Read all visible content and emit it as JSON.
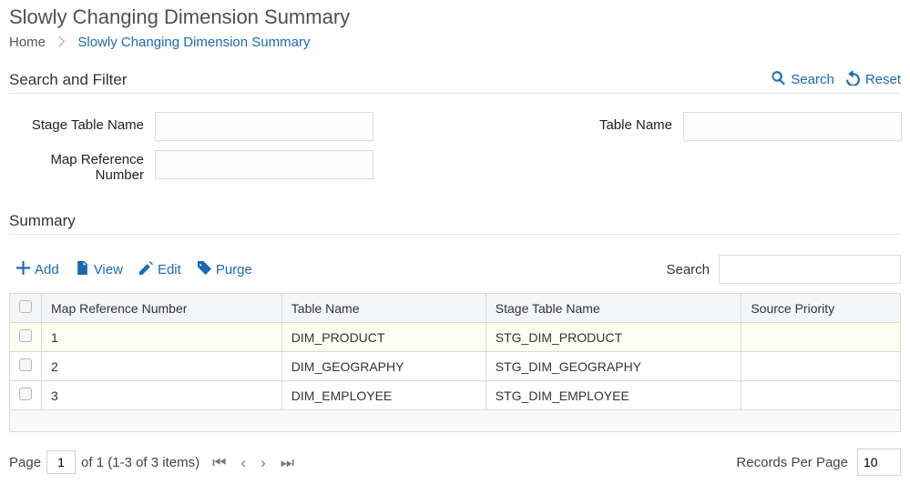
{
  "page": {
    "title": "Slowly Changing Dimension Summary",
    "breadcrumb_home": "Home",
    "breadcrumb_current": "Slowly Changing Dimension Summary"
  },
  "search_filter": {
    "heading": "Search and Filter",
    "search_label": "Search",
    "reset_label": "Reset",
    "stage_table_label": "Stage Table Name",
    "stage_table_value": "",
    "table_name_label": "Table Name",
    "table_name_value": "",
    "map_ref_label": "Map Reference Number",
    "map_ref_value": ""
  },
  "summary": {
    "heading": "Summary",
    "toolbar": {
      "add_label": "Add",
      "view_label": "View",
      "edit_label": "Edit",
      "purge_label": "Purge",
      "search_label": "Search",
      "search_value": ""
    },
    "columns": {
      "map_ref": "Map Reference Number",
      "table_name": "Table Name",
      "stage_table": "Stage Table Name",
      "source_priority": "Source Priority"
    },
    "rows": [
      {
        "map_ref": "1",
        "table_name": "DIM_PRODUCT",
        "stage_table": "STG_DIM_PRODUCT",
        "source_priority": ""
      },
      {
        "map_ref": "2",
        "table_name": "DIM_GEOGRAPHY",
        "stage_table": "STG_DIM_GEOGRAPHY",
        "source_priority": ""
      },
      {
        "map_ref": "3",
        "table_name": "DIM_EMPLOYEE",
        "stage_table": "STG_DIM_EMPLOYEE",
        "source_priority": ""
      }
    ]
  },
  "pager": {
    "page_label": "Page",
    "page_value": "1",
    "of_text": "of 1 (1-3 of 3 items)",
    "rpp_label": "Records Per Page",
    "rpp_value": "10"
  }
}
